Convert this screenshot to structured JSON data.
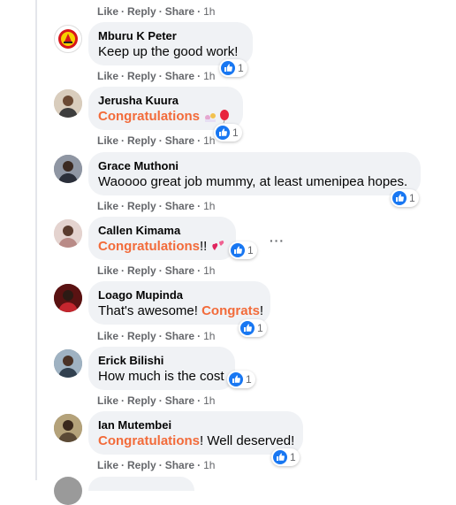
{
  "actions": {
    "like": "Like",
    "reply": "Reply",
    "share": "Share",
    "sep": "·"
  },
  "comments": [
    {
      "author": "",
      "time": "1h"
    },
    {
      "author": "Mburu K Peter",
      "text": "Keep up the good work!",
      "likes": "1",
      "time": "1h"
    },
    {
      "author": "Jerusha Kuura",
      "highlight": "Congratulations",
      "likes": "1",
      "time": "1h"
    },
    {
      "author": "Grace Muthoni",
      "text": "Waoooo great job mummy, at least umenipea hopes.",
      "likes": "1",
      "time": "1h"
    },
    {
      "author": "Callen Kimama",
      "highlight": "Congratulations",
      "after": "!!",
      "likes": "1",
      "time": "1h"
    },
    {
      "author": "Loago Mupinda",
      "before": "That's awesome! ",
      "highlight": "Congrats",
      "after": "!",
      "likes": "1",
      "time": "1h"
    },
    {
      "author": "Erick Bilishi",
      "text": "How much is the cost",
      "likes": "1",
      "time": "1h"
    },
    {
      "author": "Ian Mutembei",
      "highlight": "Congratulations",
      "after": "! Well deserved!",
      "likes": "1",
      "time": "1h"
    }
  ],
  "more_options": "···",
  "colors": {
    "like_blue": "#1877f2",
    "highlight": "#f26b3a",
    "bubble": "#f0f2f5"
  }
}
